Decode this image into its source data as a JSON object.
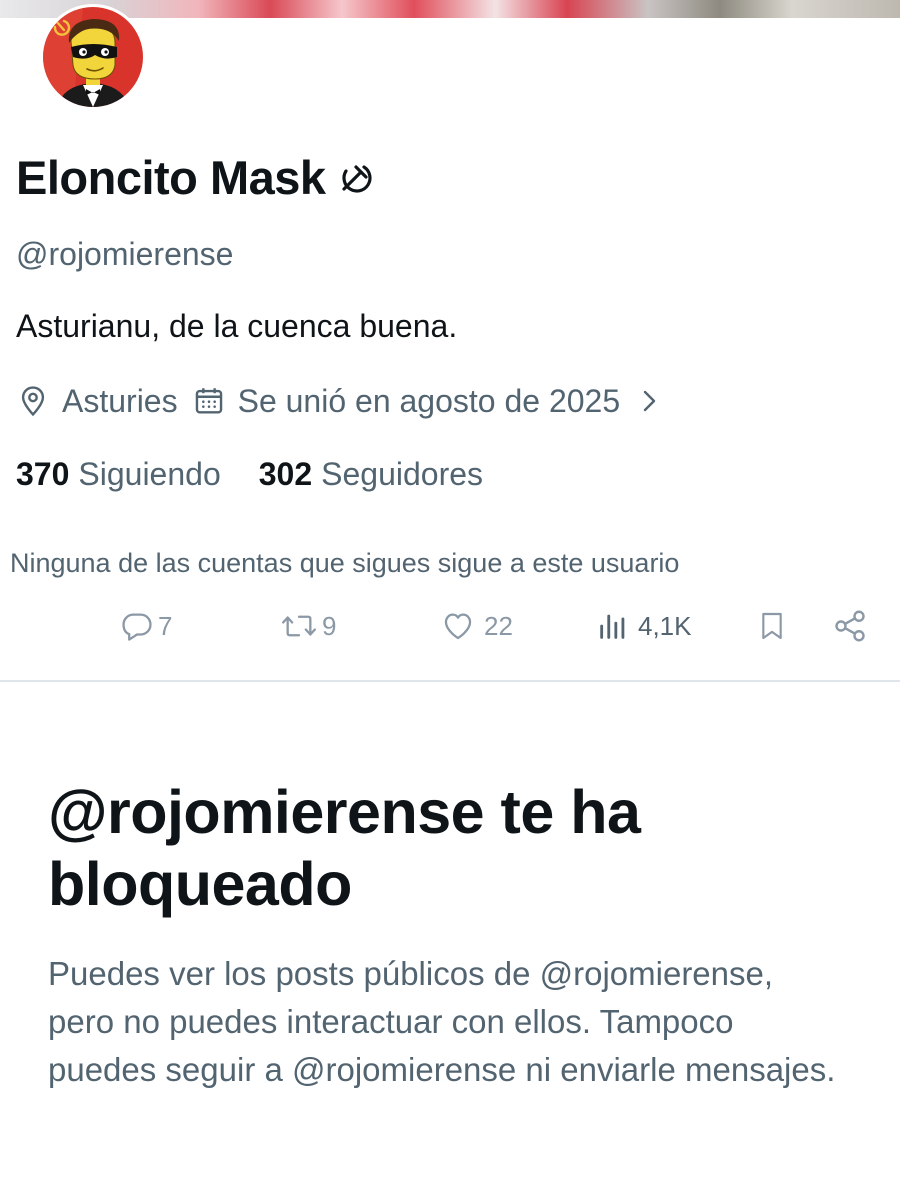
{
  "profile": {
    "display_name": "Eloncito Mask",
    "name_emoji": "☭",
    "handle": "@rojomierense",
    "bio": "Asturianu, de la cuenca buena.",
    "location": "Asturies",
    "joined": "Se unió en agosto de 2025",
    "following_count": "370",
    "following_label": "Siguiendo",
    "followers_count": "302",
    "followers_label": "Seguidores",
    "mutuals_notice": "Ninguna de las cuentas que sigues sigue a este usuario"
  },
  "post_actions": {
    "replies": "7",
    "reposts": "9",
    "likes": "22",
    "views": "4,1K"
  },
  "blocked": {
    "title": "@rojomierense te ha bloqueado",
    "body": "Puedes ver los posts públicos de @rojomierense, pero no puedes interactuar con ellos. Tampoco puedes seguir a @rojomierense ni enviarle mensajes."
  },
  "icons": {
    "location": "location-pin-icon",
    "calendar": "calendar-icon",
    "chevron": "chevron-right-icon",
    "reply": "reply-icon",
    "repost": "repost-icon",
    "like": "heart-icon",
    "views": "views-chart-icon",
    "bookmark": "bookmark-icon",
    "share": "share-icon"
  },
  "colors": {
    "text_primary": "#0f1419",
    "text_secondary": "#536471",
    "action_gray": "#8b98a5",
    "divider": "#dfe5ea",
    "avatar_background": "#d9342b"
  }
}
